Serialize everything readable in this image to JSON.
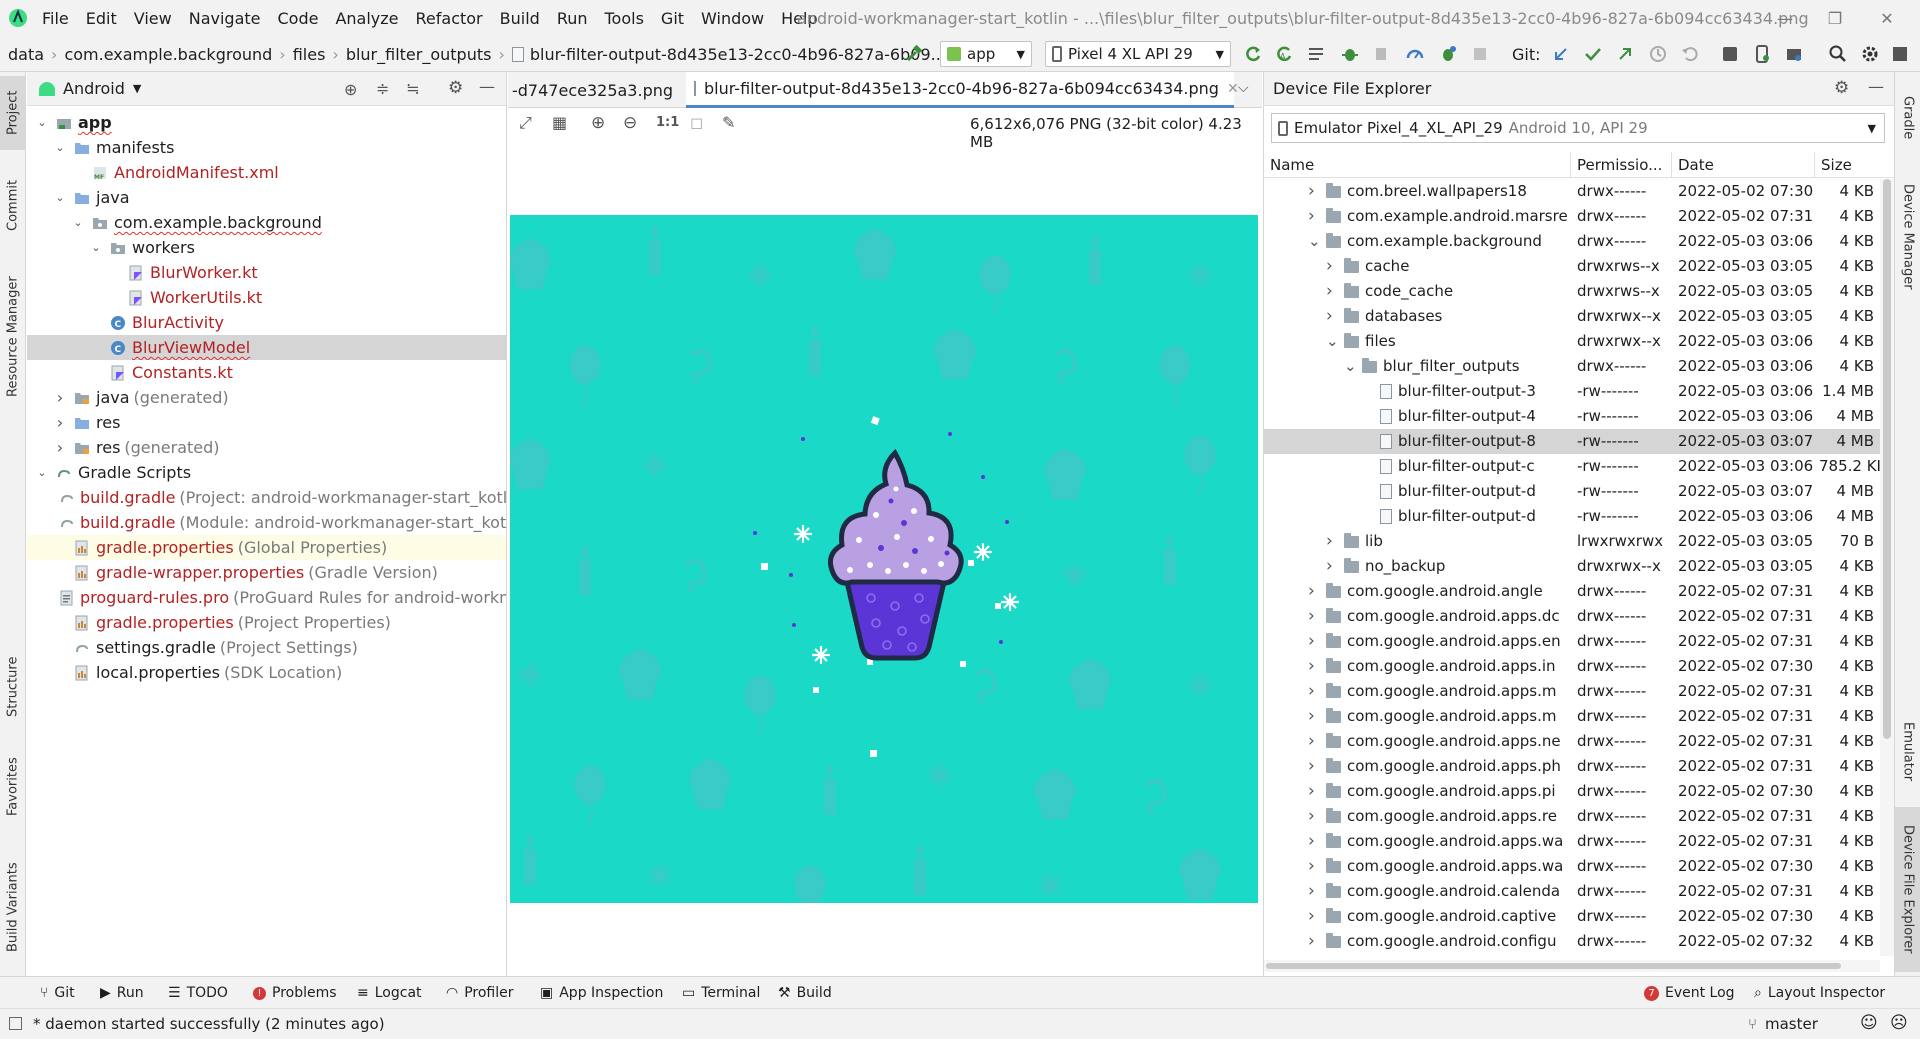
{
  "menubar": {
    "items": [
      "File",
      "Edit",
      "View",
      "Navigate",
      "Code",
      "Analyze",
      "Refactor",
      "Build",
      "Run",
      "Tools",
      "Git",
      "Window",
      "Help"
    ],
    "window_title": "android-workmanager-start_kotlin - ...\\files\\blur_filter_outputs\\blur-filter-output-8d435e13-2cc0-4b96-827a-6b094cc63434.png"
  },
  "navbar": {
    "crumbs": [
      "data",
      "com.example.background",
      "files",
      "blur_filter_outputs",
      "blur-filter-output-8d435e13-2cc0-4b96-827a-6b09..."
    ],
    "run_config": "app",
    "device": "Pixel 4 XL API 29",
    "git_label": "Git:"
  },
  "left_strip": [
    "Project",
    "Commit",
    "Resource Manager",
    "Structure",
    "Favorites",
    "Build Variants"
  ],
  "right_strip": [
    "Gradle",
    "Device Manager",
    "Emulator",
    "Device File Explorer"
  ],
  "project": {
    "view_selector": "Android",
    "tree": [
      {
        "label": "app",
        "hint": ""
      },
      {
        "label": "manifests",
        "hint": ""
      },
      {
        "label": "AndroidManifest.xml",
        "hint": ""
      },
      {
        "label": "java",
        "hint": ""
      },
      {
        "label": "com.example.background",
        "hint": ""
      },
      {
        "label": "workers",
        "hint": ""
      },
      {
        "label": "BlurWorker.kt",
        "hint": ""
      },
      {
        "label": "WorkerUtils.kt",
        "hint": ""
      },
      {
        "label": "BlurActivity",
        "hint": ""
      },
      {
        "label": "BlurViewModel",
        "hint": ""
      },
      {
        "label": "Constants.kt",
        "hint": ""
      },
      {
        "label": "java",
        "hint": "(generated)"
      },
      {
        "label": "res",
        "hint": ""
      },
      {
        "label": "res",
        "hint": "(generated)"
      },
      {
        "label": "Gradle Scripts",
        "hint": ""
      },
      {
        "label": "build.gradle",
        "hint": "(Project: android-workmanager-start_kotlin)"
      },
      {
        "label": "build.gradle",
        "hint": "(Module: android-workmanager-start_kotlin.app)"
      },
      {
        "label": "gradle.properties",
        "hint": "(Global Properties)"
      },
      {
        "label": "gradle-wrapper.properties",
        "hint": "(Gradle Version)"
      },
      {
        "label": "proguard-rules.pro",
        "hint": "(ProGuard Rules for android-workmanager)"
      },
      {
        "label": "gradle.properties",
        "hint": "(Project Properties)"
      },
      {
        "label": "settings.gradle",
        "hint": "(Project Settings)"
      },
      {
        "label": "local.properties",
        "hint": "(SDK Location)"
      }
    ]
  },
  "editor": {
    "tabs": [
      "-d747ece325a3.png",
      "blur-filter-output-8d435e13-2cc0-4b96-827a-6b094cc63434.png"
    ],
    "zoom_actual": "1:1",
    "image_info": "6,612x6,076 PNG (32-bit color) 4.23 MB"
  },
  "dfe": {
    "title": "Device File Explorer",
    "device": "Emulator Pixel_4_XL_API_29",
    "device_detail": "Android 10, API 29",
    "columns": [
      "Name",
      "Permissio...",
      "Date",
      "Size"
    ],
    "rows": [
      {
        "name": "com.breel.wallpapers18",
        "perm": "drwx------",
        "date": "2022-05-02 07:30",
        "size": "4 KB"
      },
      {
        "name": "com.example.android.marsre",
        "perm": "drwx------",
        "date": "2022-05-02 07:31",
        "size": "4 KB"
      },
      {
        "name": "com.example.background",
        "perm": "drwx------",
        "date": "2022-05-03 03:06",
        "size": "4 KB"
      },
      {
        "name": "cache",
        "perm": "drwxrws--x",
        "date": "2022-05-03 03:05",
        "size": "4 KB"
      },
      {
        "name": "code_cache",
        "perm": "drwxrws--x",
        "date": "2022-05-03 03:05",
        "size": "4 KB"
      },
      {
        "name": "databases",
        "perm": "drwxrwx--x",
        "date": "2022-05-03 03:05",
        "size": "4 KB"
      },
      {
        "name": "files",
        "perm": "drwxrwx--x",
        "date": "2022-05-03 03:06",
        "size": "4 KB"
      },
      {
        "name": "blur_filter_outputs",
        "perm": "drwx------",
        "date": "2022-05-03 03:06",
        "size": "4 KB"
      },
      {
        "name": "blur-filter-output-3",
        "perm": "-rw-------",
        "date": "2022-05-03 03:06",
        "size": "1.4 MB"
      },
      {
        "name": "blur-filter-output-4",
        "perm": "-rw-------",
        "date": "2022-05-03 03:06",
        "size": "4 MB"
      },
      {
        "name": "blur-filter-output-8",
        "perm": "-rw-------",
        "date": "2022-05-03 03:07",
        "size": "4 MB"
      },
      {
        "name": "blur-filter-output-c",
        "perm": "-rw-------",
        "date": "2022-05-03 03:06",
        "size": "785.2 KI"
      },
      {
        "name": "blur-filter-output-d",
        "perm": "-rw-------",
        "date": "2022-05-03 03:07",
        "size": "4 MB"
      },
      {
        "name": "blur-filter-output-d",
        "perm": "-rw-------",
        "date": "2022-05-03 03:06",
        "size": "4 MB"
      },
      {
        "name": "lib",
        "perm": "lrwxrwxrwx",
        "date": "2022-05-03 03:05",
        "size": "70 B"
      },
      {
        "name": "no_backup",
        "perm": "drwxrwx--x",
        "date": "2022-05-03 03:05",
        "size": "4 KB"
      },
      {
        "name": "com.google.android.angle",
        "perm": "drwx------",
        "date": "2022-05-02 07:31",
        "size": "4 KB"
      },
      {
        "name": "com.google.android.apps.dc",
        "perm": "drwx------",
        "date": "2022-05-02 07:31",
        "size": "4 KB"
      },
      {
        "name": "com.google.android.apps.en",
        "perm": "drwx------",
        "date": "2022-05-02 07:31",
        "size": "4 KB"
      },
      {
        "name": "com.google.android.apps.in",
        "perm": "drwx------",
        "date": "2022-05-02 07:30",
        "size": "4 KB"
      },
      {
        "name": "com.google.android.apps.m",
        "perm": "drwx------",
        "date": "2022-05-02 07:31",
        "size": "4 KB"
      },
      {
        "name": "com.google.android.apps.m",
        "perm": "drwx------",
        "date": "2022-05-02 07:31",
        "size": "4 KB"
      },
      {
        "name": "com.google.android.apps.ne",
        "perm": "drwx------",
        "date": "2022-05-02 07:31",
        "size": "4 KB"
      },
      {
        "name": "com.google.android.apps.ph",
        "perm": "drwx------",
        "date": "2022-05-02 07:31",
        "size": "4 KB"
      },
      {
        "name": "com.google.android.apps.pi",
        "perm": "drwx------",
        "date": "2022-05-02 07:30",
        "size": "4 KB"
      },
      {
        "name": "com.google.android.apps.re",
        "perm": "drwx------",
        "date": "2022-05-02 07:31",
        "size": "4 KB"
      },
      {
        "name": "com.google.android.apps.wa",
        "perm": "drwx------",
        "date": "2022-05-02 07:31",
        "size": "4 KB"
      },
      {
        "name": "com.google.android.apps.wa",
        "perm": "drwx------",
        "date": "2022-05-02 07:30",
        "size": "4 KB"
      },
      {
        "name": "com.google.android.calenda",
        "perm": "drwx------",
        "date": "2022-05-02 07:31",
        "size": "4 KB"
      },
      {
        "name": "com.google.android.captive",
        "perm": "drwx------",
        "date": "2022-05-02 07:30",
        "size": "4 KB"
      },
      {
        "name": "com.google.android.configu",
        "perm": "drwx------",
        "date": "2022-05-02 07:32",
        "size": "4 KB"
      }
    ]
  },
  "bottombar": {
    "left": [
      "Git",
      "Run",
      "TODO",
      "Problems",
      "Logcat",
      "Profiler",
      "App Inspection",
      "Terminal",
      "Build"
    ],
    "right": [
      "Event Log",
      "Layout Inspector"
    ],
    "event_count": "7"
  },
  "status": {
    "message": "* daemon started successfully (2 minutes ago)",
    "branch": "master"
  },
  "colors": {
    "accent": "#4a88c7",
    "image_bg": "#1ad9c6",
    "cupcake_frosting": "#b9a0e3",
    "cupcake_base": "#5b35d6",
    "selection": "#d5d5d5"
  }
}
